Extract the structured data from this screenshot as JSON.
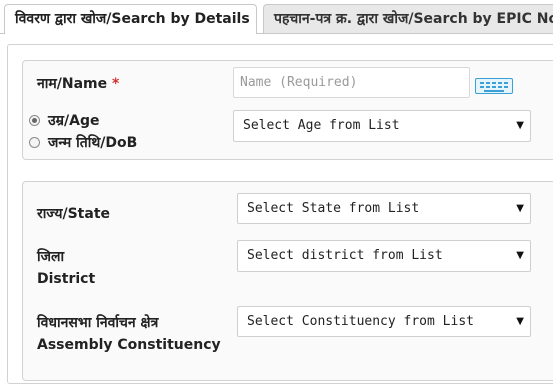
{
  "tabs": [
    {
      "label": "विवरण द्वारा खोज/Search by Details",
      "active": true
    },
    {
      "label": "पहचान-पत्र क्र. द्वारा खोज/Search by EPIC No",
      "active": false
    }
  ],
  "personal": {
    "name_label": "नाम/Name",
    "required_mark": "*",
    "name_placeholder": "Name (Required)",
    "age_option_label": "उम्र/Age",
    "dob_option_label": "जन्म तिथि/DoB",
    "age_select_value": "Select Age from List",
    "selected_option": "age"
  },
  "location": {
    "state_label": "राज्य/State",
    "state_select_value": "Select State from List",
    "district_label_hi": "जिला",
    "district_label_en": "District",
    "district_select_value": "Select district from List",
    "constituency_label_hi": "विधानसभा निर्वाचन क्षेत्र",
    "constituency_label_en": "Assembly Constituency",
    "constituency_select_value": "Select Constituency from List"
  },
  "icons": {
    "keyboard": "keyboard-icon",
    "dropdown": "chevron-down-icon",
    "accent": "#3aa0d6"
  }
}
